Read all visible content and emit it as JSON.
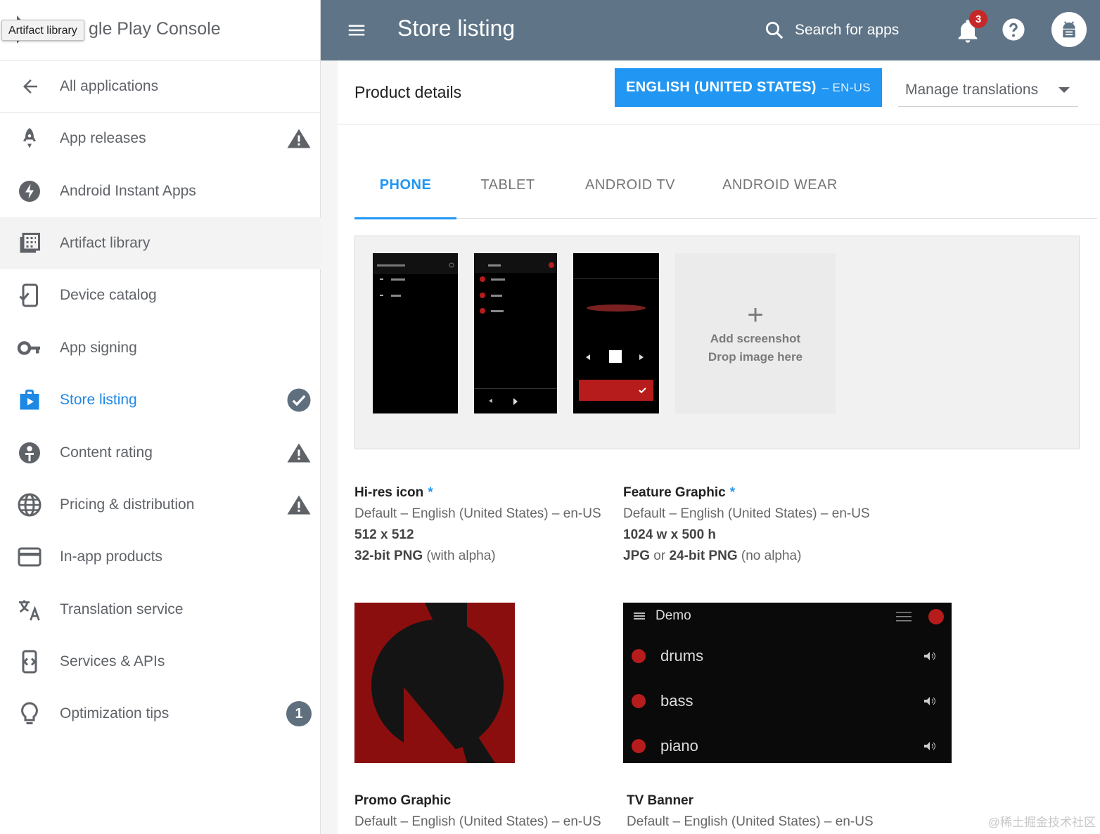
{
  "brand": {
    "title": "gle Play Console",
    "tooltip": "Artifact library"
  },
  "sidebar": {
    "back_label": "All applications",
    "items": [
      {
        "label": "App releases",
        "icon": "rocket-icon",
        "status": "warning"
      },
      {
        "label": "Android Instant Apps",
        "icon": "bolt-icon",
        "status": ""
      },
      {
        "label": "Artifact library",
        "icon": "library-icon",
        "status": ""
      },
      {
        "label": "Device catalog",
        "icon": "device-check-icon",
        "status": ""
      },
      {
        "label": "App signing",
        "icon": "key-icon",
        "status": ""
      },
      {
        "label": "Store listing",
        "icon": "store-icon",
        "status": "check"
      },
      {
        "label": "Content rating",
        "icon": "rating-icon",
        "status": "warning"
      },
      {
        "label": "Pricing & distribution",
        "icon": "globe-icon",
        "status": "warning"
      },
      {
        "label": "In-app products",
        "icon": "card-icon",
        "status": ""
      },
      {
        "label": "Translation service",
        "icon": "translate-icon",
        "status": ""
      },
      {
        "label": "Services & APIs",
        "icon": "api-icon",
        "status": ""
      },
      {
        "label": "Optimization tips",
        "icon": "bulb-icon",
        "status": "1"
      }
    ]
  },
  "topbar": {
    "title": "Store listing",
    "search_label": "Search for apps",
    "notification_count": "3"
  },
  "main": {
    "section_title": "Product details",
    "language_button": "ENGLISH (UNITED STATES)",
    "language_code": "– EN-US",
    "manage_translations": "Manage translations",
    "tabs": [
      "PHONE",
      "TABLET",
      "ANDROID TV",
      "ANDROID WEAR"
    ],
    "add_screenshot": "Add screenshot",
    "drop_image": "Drop image here",
    "hires": {
      "title": "Hi-res icon",
      "req": "*",
      "default": "Default – English (United States) – en-US",
      "size": "512 x 512",
      "format_bold": "32-bit PNG",
      "format_rest": " (with alpha)"
    },
    "feature": {
      "title": "Feature Graphic",
      "req": "*",
      "default": "Default – English (United States) – en-US",
      "size": "1024 w x 500 h",
      "format_bold1": "JPG",
      "format_mid": " or ",
      "format_bold2": "24-bit PNG",
      "format_rest": " (no alpha)",
      "preview": {
        "title": "Demo",
        "rows": [
          "drums",
          "bass",
          "piano"
        ]
      }
    },
    "promo": {
      "title": "Promo Graphic",
      "default": "Default – English (United States) – en-US"
    },
    "tv_banner": {
      "title": "TV Banner",
      "default": "Default – English (United States) – en-US"
    }
  },
  "colors": {
    "accent": "#2196f3",
    "topbar": "#5f7487",
    "warning": "#5f6368",
    "badge": "#c62828"
  },
  "watermark": "@稀土掘金技术社区"
}
